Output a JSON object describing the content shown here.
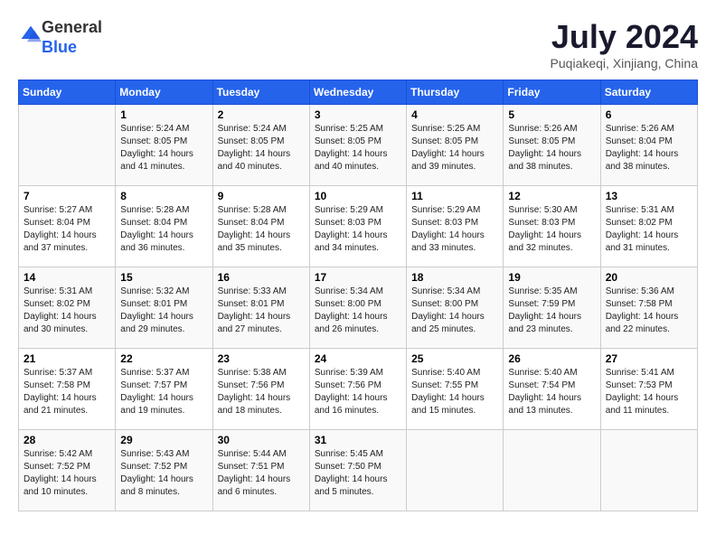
{
  "header": {
    "logo": {
      "line1": "General",
      "line2": "Blue"
    },
    "title": "July 2024",
    "location": "Puqiakeqi, Xinjiang, China"
  },
  "days_of_week": [
    "Sunday",
    "Monday",
    "Tuesday",
    "Wednesday",
    "Thursday",
    "Friday",
    "Saturday"
  ],
  "weeks": [
    [
      {
        "date": "",
        "info": ""
      },
      {
        "date": "1",
        "info": "Sunrise: 5:24 AM\nSunset: 8:05 PM\nDaylight: 14 hours\nand 41 minutes."
      },
      {
        "date": "2",
        "info": "Sunrise: 5:24 AM\nSunset: 8:05 PM\nDaylight: 14 hours\nand 40 minutes."
      },
      {
        "date": "3",
        "info": "Sunrise: 5:25 AM\nSunset: 8:05 PM\nDaylight: 14 hours\nand 40 minutes."
      },
      {
        "date": "4",
        "info": "Sunrise: 5:25 AM\nSunset: 8:05 PM\nDaylight: 14 hours\nand 39 minutes."
      },
      {
        "date": "5",
        "info": "Sunrise: 5:26 AM\nSunset: 8:05 PM\nDaylight: 14 hours\nand 38 minutes."
      },
      {
        "date": "6",
        "info": "Sunrise: 5:26 AM\nSunset: 8:04 PM\nDaylight: 14 hours\nand 38 minutes."
      }
    ],
    [
      {
        "date": "7",
        "info": "Sunrise: 5:27 AM\nSunset: 8:04 PM\nDaylight: 14 hours\nand 37 minutes."
      },
      {
        "date": "8",
        "info": "Sunrise: 5:28 AM\nSunset: 8:04 PM\nDaylight: 14 hours\nand 36 minutes."
      },
      {
        "date": "9",
        "info": "Sunrise: 5:28 AM\nSunset: 8:04 PM\nDaylight: 14 hours\nand 35 minutes."
      },
      {
        "date": "10",
        "info": "Sunrise: 5:29 AM\nSunset: 8:03 PM\nDaylight: 14 hours\nand 34 minutes."
      },
      {
        "date": "11",
        "info": "Sunrise: 5:29 AM\nSunset: 8:03 PM\nDaylight: 14 hours\nand 33 minutes."
      },
      {
        "date": "12",
        "info": "Sunrise: 5:30 AM\nSunset: 8:03 PM\nDaylight: 14 hours\nand 32 minutes."
      },
      {
        "date": "13",
        "info": "Sunrise: 5:31 AM\nSunset: 8:02 PM\nDaylight: 14 hours\nand 31 minutes."
      }
    ],
    [
      {
        "date": "14",
        "info": "Sunrise: 5:31 AM\nSunset: 8:02 PM\nDaylight: 14 hours\nand 30 minutes."
      },
      {
        "date": "15",
        "info": "Sunrise: 5:32 AM\nSunset: 8:01 PM\nDaylight: 14 hours\nand 29 minutes."
      },
      {
        "date": "16",
        "info": "Sunrise: 5:33 AM\nSunset: 8:01 PM\nDaylight: 14 hours\nand 27 minutes."
      },
      {
        "date": "17",
        "info": "Sunrise: 5:34 AM\nSunset: 8:00 PM\nDaylight: 14 hours\nand 26 minutes."
      },
      {
        "date": "18",
        "info": "Sunrise: 5:34 AM\nSunset: 8:00 PM\nDaylight: 14 hours\nand 25 minutes."
      },
      {
        "date": "19",
        "info": "Sunrise: 5:35 AM\nSunset: 7:59 PM\nDaylight: 14 hours\nand 23 minutes."
      },
      {
        "date": "20",
        "info": "Sunrise: 5:36 AM\nSunset: 7:58 PM\nDaylight: 14 hours\nand 22 minutes."
      }
    ],
    [
      {
        "date": "21",
        "info": "Sunrise: 5:37 AM\nSunset: 7:58 PM\nDaylight: 14 hours\nand 21 minutes."
      },
      {
        "date": "22",
        "info": "Sunrise: 5:37 AM\nSunset: 7:57 PM\nDaylight: 14 hours\nand 19 minutes."
      },
      {
        "date": "23",
        "info": "Sunrise: 5:38 AM\nSunset: 7:56 PM\nDaylight: 14 hours\nand 18 minutes."
      },
      {
        "date": "24",
        "info": "Sunrise: 5:39 AM\nSunset: 7:56 PM\nDaylight: 14 hours\nand 16 minutes."
      },
      {
        "date": "25",
        "info": "Sunrise: 5:40 AM\nSunset: 7:55 PM\nDaylight: 14 hours\nand 15 minutes."
      },
      {
        "date": "26",
        "info": "Sunrise: 5:40 AM\nSunset: 7:54 PM\nDaylight: 14 hours\nand 13 minutes."
      },
      {
        "date": "27",
        "info": "Sunrise: 5:41 AM\nSunset: 7:53 PM\nDaylight: 14 hours\nand 11 minutes."
      }
    ],
    [
      {
        "date": "28",
        "info": "Sunrise: 5:42 AM\nSunset: 7:52 PM\nDaylight: 14 hours\nand 10 minutes."
      },
      {
        "date": "29",
        "info": "Sunrise: 5:43 AM\nSunset: 7:52 PM\nDaylight: 14 hours\nand 8 minutes."
      },
      {
        "date": "30",
        "info": "Sunrise: 5:44 AM\nSunset: 7:51 PM\nDaylight: 14 hours\nand 6 minutes."
      },
      {
        "date": "31",
        "info": "Sunrise: 5:45 AM\nSunset: 7:50 PM\nDaylight: 14 hours\nand 5 minutes."
      },
      {
        "date": "",
        "info": ""
      },
      {
        "date": "",
        "info": ""
      },
      {
        "date": "",
        "info": ""
      }
    ]
  ]
}
